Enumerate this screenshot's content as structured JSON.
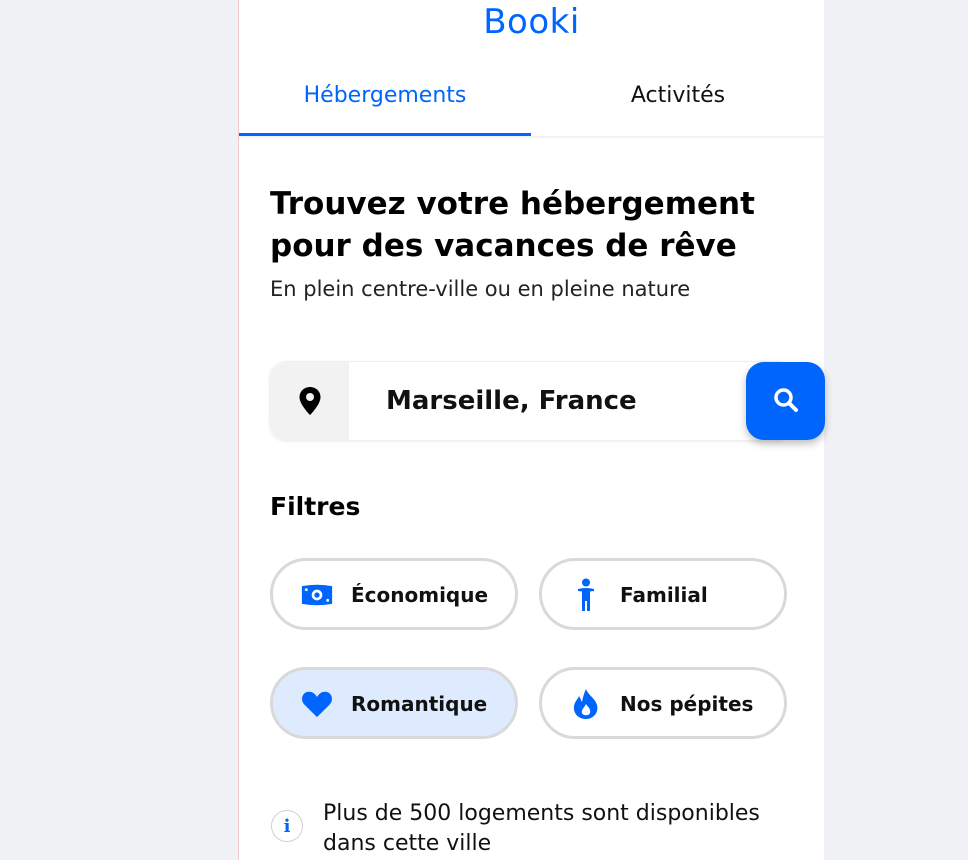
{
  "app": {
    "logo": "Booki"
  },
  "tabs": [
    {
      "label": "Hébergements",
      "active": true
    },
    {
      "label": "Activités",
      "active": false
    }
  ],
  "hero": {
    "title": "Trouvez votre hébergement pour des vacances de rêve",
    "subtitle": "En plein centre-ville ou en pleine nature"
  },
  "search": {
    "value": "Marseille, France",
    "pin_icon": "location-pin-icon",
    "button_icon": "search-icon"
  },
  "filters": {
    "title": "Filtres",
    "items": [
      {
        "label": "Économique",
        "icon": "money-icon",
        "selected": false
      },
      {
        "label": "Familial",
        "icon": "person-icon",
        "selected": false
      },
      {
        "label": "Romantique",
        "icon": "heart-icon",
        "selected": true
      },
      {
        "label": "Nos pépites",
        "icon": "flame-icon",
        "selected": false
      }
    ]
  },
  "info": {
    "icon": "info-icon",
    "text": "Plus de 500 logements sont disponibles dans cette ville"
  },
  "colors": {
    "brand": "#0065fc",
    "selected_chip": "#deebff",
    "background": "#f0f1f4"
  }
}
